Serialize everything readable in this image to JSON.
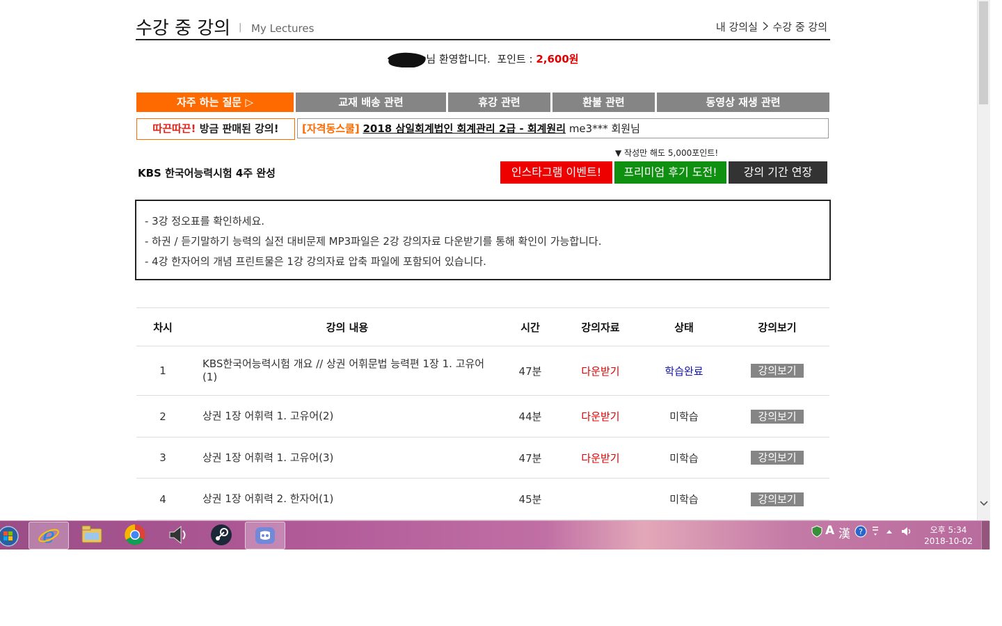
{
  "header": {
    "title": "수강 중 강의",
    "separator": "|",
    "subtitle": "My Lectures",
    "breadcrumb_home": "내 강의실",
    "breadcrumb_current": "수강 중 강의"
  },
  "welcome": {
    "greeting": "님 환영합니다.",
    "points_label": "포인트 :",
    "points_value": "2,600원"
  },
  "tabs": [
    {
      "label": "자주 하는 질문 ▷",
      "active": true
    },
    {
      "label": "교재 배송 관련"
    },
    {
      "label": "휴강 관련"
    },
    {
      "label": "환불 관련"
    },
    {
      "label": "동영상 재생 관련"
    }
  ],
  "ticker": {
    "hot_label": "따끈따끈!",
    "hot_suffix": "방금 판매된 강의!",
    "category": "[자격동스쿨]",
    "course": "2018 삼일회계법인 회계관리 2급 - 회계원리",
    "user": "me3*** 회원님"
  },
  "course_title": "KBS 한국어능력시험 4주 완성",
  "review_note": "▼ 작성만 해도 5,000포인트!",
  "buttons": {
    "instagram": "인스타그램 이벤트!",
    "premium_review": "프리미엄 후기 도전!",
    "extend": "강의 기간 연장"
  },
  "notices": [
    "- 3강 정오표를 확인하세요.",
    "- 하권 / 듣기말하기 능력의 실전 대비문제 MP3파일은 2강 강의자료 다운받기를 통해 확인이 가능합니다.",
    "- 4강 한자어의 개념 프린트물은 1강 강의자료 압축 파일에 포함되어 있습니다."
  ],
  "table": {
    "headers": [
      "차시",
      "강의 내용",
      "시간",
      "강의자료",
      "상태",
      "강의보기"
    ],
    "rows": [
      {
        "no": "1",
        "title": "KBS한국어능력시험 개요 // 상권 어휘문법 능력편 1장 1. 고유어(1)",
        "time": "47분",
        "material": "다운받기",
        "status": "학습완료",
        "view": "강의보기"
      },
      {
        "no": "2",
        "title": "상권 1장 어휘력 1. 고유어(2)",
        "time": "44분",
        "material": "다운받기",
        "status": "미학습",
        "view": "강의보기"
      },
      {
        "no": "3",
        "title": "상권 1장 어휘력 1. 고유어(3)",
        "time": "47분",
        "material": "다운받기",
        "status": "미학습",
        "view": "강의보기"
      },
      {
        "no": "4",
        "title": "상권 1장 어휘력 2. 한자어(1)",
        "time": "45분",
        "material": "",
        "status": "미학습",
        "view": "강의보기"
      }
    ]
  },
  "taskbar": {
    "apps": [
      "start-orb-icon",
      "internet-explorer-icon",
      "file-explorer-icon",
      "chrome-icon",
      "speaker-app-icon",
      "steam-icon",
      "discord-icon"
    ],
    "ime_a": "A",
    "ime_han": "漢",
    "clock_time": "오후 5:34",
    "clock_date": "2018-10-02"
  },
  "colors": {
    "accent_orange": "#ff6a00",
    "tab_gray": "#858585",
    "points_red": "#e00000",
    "status_done_blue": "#1010c0",
    "premium_green": "#109010"
  }
}
